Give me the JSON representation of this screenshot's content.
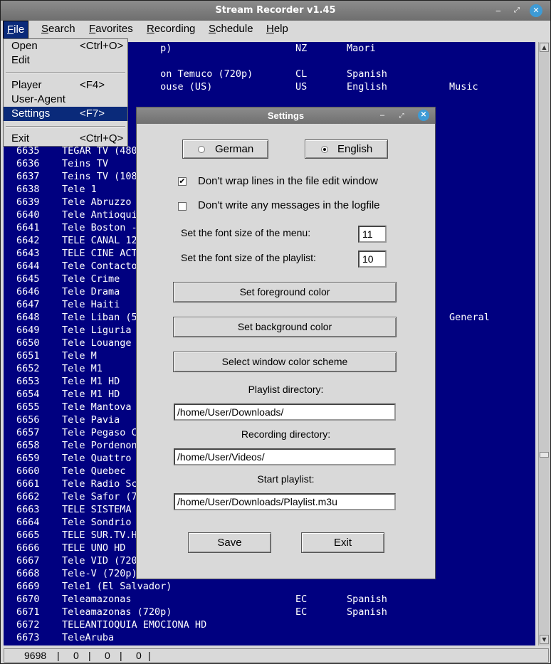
{
  "window": {
    "title": "Stream Recorder v1.45"
  },
  "menubar": [
    {
      "first": "F",
      "rest": "ile"
    },
    {
      "first": "S",
      "rest": "earch"
    },
    {
      "first": "F",
      "rest": "avorites"
    },
    {
      "first": "R",
      "rest": "ecording"
    },
    {
      "first": "S",
      "rest": "chedule"
    },
    {
      "first": "H",
      "rest": "elp"
    }
  ],
  "file_menu": {
    "open": {
      "label": "Open",
      "accel": "<Ctrl+O>"
    },
    "edit": {
      "label": "Edit",
      "accel": ""
    },
    "player": {
      "label": "Player",
      "accel": "<F4>"
    },
    "user_agent": {
      "label": "User-Agent",
      "accel": ""
    },
    "settings": {
      "label": "Settings",
      "accel": "<F7>"
    },
    "exit": {
      "label": "Exit",
      "accel": "<Ctrl+Q>"
    }
  },
  "list": {
    "rows": [
      {
        "num": "",
        "name": "                 p)",
        "cc": "NZ",
        "lang": "Maori",
        "genre": ""
      },
      {
        "num": "",
        "name": "",
        "cc": "",
        "lang": "",
        "genre": ""
      },
      {
        "num": "",
        "name": "                 on Temuco (720p)",
        "cc": "CL",
        "lang": "Spanish",
        "genre": ""
      },
      {
        "num": "",
        "name": "                 ouse (US)",
        "cc": "US",
        "lang": "English",
        "genre": "Music"
      },
      {
        "num": "",
        "name": "",
        "cc": "",
        "lang": "",
        "genre": ""
      },
      {
        "num": "",
        "name": "",
        "cc": "",
        "lang": "",
        "genre": ""
      },
      {
        "num": "",
        "name": "",
        "cc": "",
        "lang": "",
        "genre": ""
      },
      {
        "num": "",
        "name": "",
        "cc": "",
        "lang": "",
        "genre": ""
      },
      {
        "num": "6635",
        "name": "TEGAR TV (480",
        "cc": "",
        "lang": "",
        "genre": ""
      },
      {
        "num": "6636",
        "name": "Teins TV",
        "cc": "",
        "lang": "",
        "genre": ""
      },
      {
        "num": "6637",
        "name": "Teins TV (108",
        "cc": "",
        "lang": "",
        "genre": ""
      },
      {
        "num": "6638",
        "name": "Tele 1",
        "cc": "",
        "lang": "",
        "genre": ""
      },
      {
        "num": "6639",
        "name": "Tele Abruzzo",
        "cc": "",
        "lang": "",
        "genre": ""
      },
      {
        "num": "6640",
        "name": "Tele Antioqui",
        "cc": "",
        "lang": "",
        "genre": ""
      },
      {
        "num": "6641",
        "name": "Tele Boston -",
        "cc": "",
        "lang": "",
        "genre": ""
      },
      {
        "num": "6642",
        "name": "TELE CANAL 12",
        "cc": "",
        "lang": "",
        "genre": ""
      },
      {
        "num": "6643",
        "name": "TELE CINE ACT",
        "cc": "",
        "lang": "",
        "genre": ""
      },
      {
        "num": "6644",
        "name": "Tele Contacto",
        "cc": "",
        "lang": "",
        "genre": ""
      },
      {
        "num": "6645",
        "name": "Tele Crime",
        "cc": "",
        "lang": "",
        "genre": ""
      },
      {
        "num": "6646",
        "name": "Tele Drama",
        "cc": "",
        "lang": "",
        "genre": ""
      },
      {
        "num": "6647",
        "name": "Tele Haiti",
        "cc": "",
        "lang": "",
        "genre": ""
      },
      {
        "num": "6648",
        "name": "Tele Liban (5",
        "cc": "",
        "lang": "",
        "genre": "General"
      },
      {
        "num": "6649",
        "name": "Tele Liguria",
        "cc": "",
        "lang": "",
        "genre": ""
      },
      {
        "num": "6650",
        "name": "Tele Louange",
        "cc": "",
        "lang": "",
        "genre": ""
      },
      {
        "num": "6651",
        "name": "Tele M",
        "cc": "",
        "lang": "",
        "genre": ""
      },
      {
        "num": "6652",
        "name": "Tele M1",
        "cc": "",
        "lang": "",
        "genre": ""
      },
      {
        "num": "6653",
        "name": "Tele M1 HD",
        "cc": "",
        "lang": "",
        "genre": ""
      },
      {
        "num": "6654",
        "name": "Tele M1 HD",
        "cc": "",
        "lang": "",
        "genre": ""
      },
      {
        "num": "6655",
        "name": "Tele Mantova",
        "cc": "",
        "lang": "",
        "genre": ""
      },
      {
        "num": "6656",
        "name": "Tele Pavia",
        "cc": "",
        "lang": "",
        "genre": ""
      },
      {
        "num": "6657",
        "name": "Tele Pegaso C",
        "cc": "",
        "lang": "",
        "genre": ""
      },
      {
        "num": "6658",
        "name": "Tele Pordenon",
        "cc": "",
        "lang": "",
        "genre": ""
      },
      {
        "num": "6659",
        "name": "Tele Quattro",
        "cc": "",
        "lang": "",
        "genre": ""
      },
      {
        "num": "6660",
        "name": "Tele Quebec",
        "cc": "",
        "lang": "",
        "genre": ""
      },
      {
        "num": "6661",
        "name": "Tele Radio Sc",
        "cc": "",
        "lang": "",
        "genre": ""
      },
      {
        "num": "6662",
        "name": "Tele Safor (7",
        "cc": "",
        "lang": "",
        "genre": ""
      },
      {
        "num": "6663",
        "name": "TELE SISTEMA",
        "cc": "",
        "lang": "",
        "genre": ""
      },
      {
        "num": "6664",
        "name": "Tele Sondrio",
        "cc": "",
        "lang": "",
        "genre": ""
      },
      {
        "num": "6665",
        "name": "TELE SUR.TV.H",
        "cc": "",
        "lang": "",
        "genre": ""
      },
      {
        "num": "6666",
        "name": "TELE UNO HD",
        "cc": "",
        "lang": "",
        "genre": ""
      },
      {
        "num": "6667",
        "name": "Tele VID (720",
        "cc": "",
        "lang": "",
        "genre": ""
      },
      {
        "num": "6668",
        "name": "Tele-V (720p)",
        "cc": "",
        "lang": "",
        "genre": ""
      },
      {
        "num": "6669",
        "name": "Tele1 (El Salvador)",
        "cc": "",
        "lang": "",
        "genre": ""
      },
      {
        "num": "6670",
        "name": "Teleamazonas",
        "cc": "EC",
        "lang": "Spanish",
        "genre": ""
      },
      {
        "num": "6671",
        "name": "Teleamazonas (720p)",
        "cc": "EC",
        "lang": "Spanish",
        "genre": ""
      },
      {
        "num": "6672",
        "name": "TELEANTIOQUIA EMOCIONA HD",
        "cc": "",
        "lang": "",
        "genre": ""
      },
      {
        "num": "6673",
        "name": "TeleAruba",
        "cc": "",
        "lang": "",
        "genre": ""
      }
    ]
  },
  "statusbar": {
    "count": "9698",
    "v1": "0",
    "v2": "0",
    "v3": "0",
    "sep": "|"
  },
  "settings": {
    "title": "Settings",
    "lang_german": "German",
    "lang_english": "English",
    "selected_language": "English",
    "wrap_lines_label": "Don't wrap lines in the file edit window",
    "wrap_lines_checked": true,
    "no_log_label": "Don't write any messages in the logfile",
    "no_log_checked": false,
    "menu_font_label": "Set the font size of the menu:",
    "menu_font_value": "11",
    "playlist_font_label": "Set the font size of the playlist:",
    "playlist_font_value": "10",
    "fg_button": "Set foreground color",
    "bg_button": "Set background color",
    "scheme_button": "Select window color scheme",
    "playlist_dir_label": "Playlist directory:",
    "playlist_dir_value": "/home/User/Downloads/",
    "recording_dir_label": "Recording directory:",
    "recording_dir_value": "/home/User/Videos/",
    "start_playlist_label": "Start playlist:",
    "start_playlist_value": "/home/User/Downloads/Playlist.m3u",
    "save_button": "Save",
    "exit_button": "Exit",
    "check_mark": "✔"
  },
  "icons": {
    "minimize": "‒",
    "maximize": "⤢",
    "close": "✕",
    "scroll_up": "▲",
    "scroll_down": "▼"
  },
  "colors": {
    "list_background": "#000080",
    "list_text": "#ffffff",
    "menu_highlight": "#0a2a7a",
    "close_button": "#3d9bd6"
  }
}
